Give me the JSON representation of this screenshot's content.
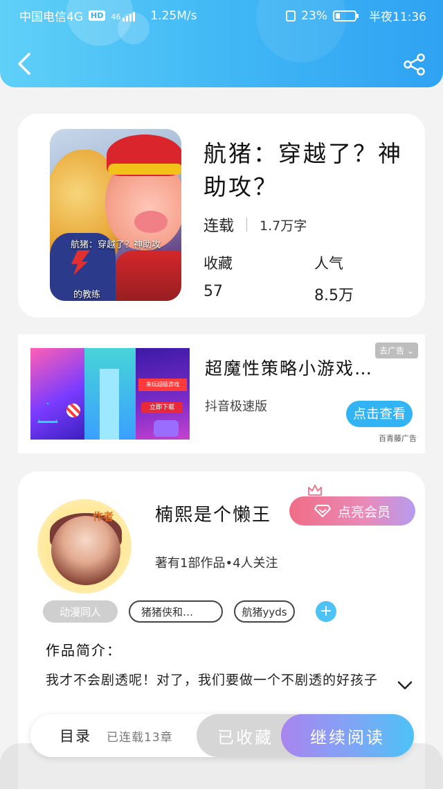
{
  "status_bar": {
    "carrier": "中国电信4G",
    "hd_badge": "HD",
    "net_type": "46",
    "speed": "1.25M/s",
    "battery_pct": "23%",
    "battery_level": 0.23,
    "time": "半夜11:36"
  },
  "header": {
    "back_icon": "back-arrow-icon",
    "share_icon": "share-icon"
  },
  "book": {
    "title": "航猪：穿越了？神助攻？",
    "status": "连载",
    "word_count": "1.7万字",
    "stats": [
      {
        "label": "收藏",
        "value": "57"
      },
      {
        "label": "人气",
        "value": "8.5万"
      }
    ],
    "cover_caption": "航猪：穿越了？神助攻",
    "cover_caption2": "的教练"
  },
  "ad": {
    "title": "超魔性策略小游戏…",
    "source": "抖音极速版",
    "tag": "去广告",
    "button": "点击查看",
    "network": "百青藤广告",
    "img_text_red": "来玩超级游戏",
    "img_text_dl": "立即下载"
  },
  "author": {
    "avatar_label": "作者",
    "name": "楠熙是个懒王",
    "vip_button": "点亮会员",
    "meta": "著有1部作品•4人关注",
    "tags": [
      "动漫同人",
      "猪猪侠和…",
      "航猪yyds"
    ],
    "intro_label": "作品简介：",
    "intro_text": "我才不会剧透呢！对了，我们要做一个不剧透的好孩子"
  },
  "bottom_bar": {
    "toc_label": "目录",
    "toc_count": "已连载13章",
    "favorite_button": "已收藏",
    "read_button": "继续阅读"
  },
  "colors": {
    "accent": "#3fb6f5",
    "vip_pink": "#f06d86",
    "tag_add": "#4ec2f4"
  }
}
